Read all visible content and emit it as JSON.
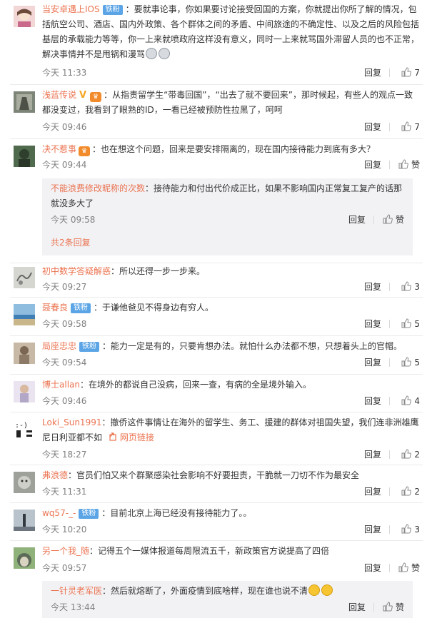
{
  "comments": [
    {
      "user": "当安卓遇上IOS",
      "badge": "铁粉",
      "text": "：要就事论事，你如果要讨论接受回国的方案，你就提出你所了解的情况，包括航空公司、酒店、国内外政策、各个群体之间的矛盾、中间旅途的不确定性、以及之后的风险包括基层的承载能力等等，你一上来就喷政府这样没有意义，同时一上来就骂国外滞留人员的也不正常，解决事情并不是甩锅和漫骂",
      "time": "今天 11:33",
      "reply": "回复",
      "likes": "7"
    },
    {
      "user": "浅蓝传说",
      "text": "：从指责留学生“带毒回国”，“出去了就不要回来”，那时候起，有些人的观点一致都没变过，我看到了眼熟的ID，一看已经被预防性拉黑了，呵呵",
      "time": "今天 09:46",
      "reply": "回复",
      "likes": "7"
    },
    {
      "user": "决不惹事",
      "text": "：也在想这个问题，回来是要安排隔离的，现在国内接待能力到底有多大？",
      "time": "今天 09:44",
      "reply": "回复",
      "likes": "赞",
      "sub": {
        "user": "不能浪费修改昵称的次数",
        "text": "：接待能力和付出代价成正比，如果不影响国内正常复工复产的话那就没多大了",
        "time": "今天 09:58",
        "reply": "回复",
        "likes": "赞",
        "more": "共2条回复"
      }
    },
    {
      "user": "初中数学答疑解惑",
      "text": "：所以还得一步一步来。",
      "time": "今天 09:27",
      "reply": "回复",
      "likes": "3"
    },
    {
      "user": "聂春良",
      "badge": "铁粉",
      "text": "：于谦他爸见不得身边有穷人。",
      "time": "今天 09:58",
      "reply": "回复",
      "likes": "5"
    },
    {
      "user": "局座忠忠",
      "badge": "铁粉",
      "text": "：能力一定是有的，只要肯想办法。就怕什么办法都不想，只想着头上的官帽。",
      "time": "今天 09:54",
      "reply": "回复",
      "likes": "5"
    },
    {
      "user": "博士allan",
      "text": "：在境外的都说自己没病，回来一查，有病的全是境外输入。",
      "time": "今天 09:46",
      "reply": "回复",
      "likes": "4"
    },
    {
      "user": "Loki_Sun1991",
      "text": "：撤侨这件事情让在海外的留学生、务工、援建的群体对祖国失望，我们连非洲雄鹰尼日利亚都不如",
      "link": "网页链接",
      "time": "今天 18:27",
      "reply": "回复",
      "likes": "2"
    },
    {
      "user": "弗浪德",
      "text": "：官员们怕又来个群聚感染社会影响不好要担责，干脆就一刀切不作为最安全",
      "time": "今天 11:31",
      "reply": "回复",
      "likes": "2"
    },
    {
      "user": "wq57-_-",
      "badge": "铁粉",
      "text": "：目前北京上海已经没有接待能力了。。",
      "time": "今天 10:20",
      "reply": "回复",
      "likes": "3"
    },
    {
      "user": "另一个我_随",
      "text": "：记得五个一媒体报道每周限流五千，新政策官方说提高了四倍",
      "time": "今天 09:57",
      "reply": "回复",
      "likes": "赞",
      "sub": {
        "user": "一针灵老军医",
        "text": "：然后就熔断了，外面疫情到底啥样，现在谁也说不清",
        "time": "今天 13:44",
        "reply": "回复",
        "likes": "赞"
      }
    }
  ],
  "colors": {
    "username": "#eb7350",
    "badge": "#5ba5e6",
    "meta": "#808080",
    "subbox": "#f2f2f5"
  }
}
